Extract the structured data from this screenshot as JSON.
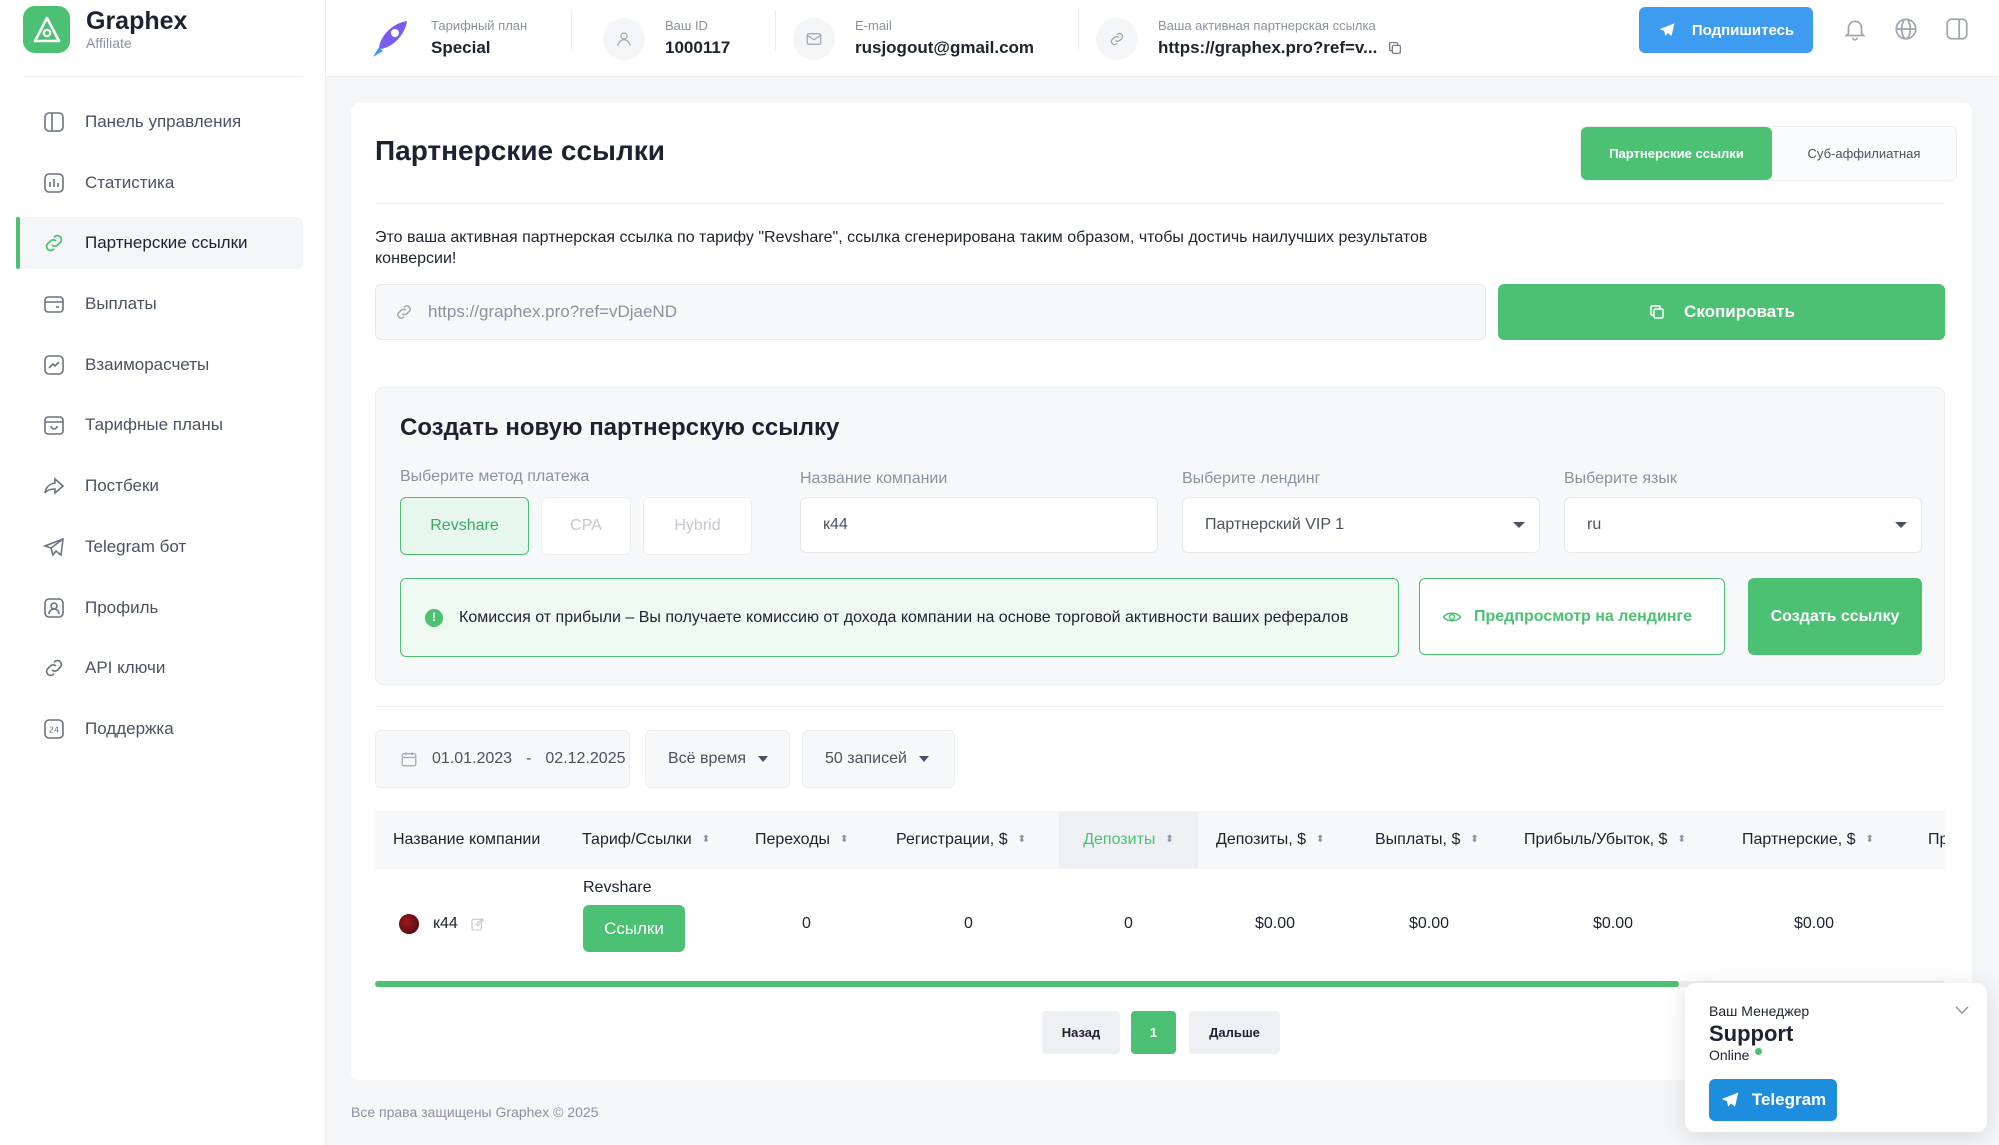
{
  "brand": {
    "name": "Graphex",
    "subtitle": "Affiliate",
    "accent": "#4cc174",
    "telegram_blue": "#3e9cf0"
  },
  "sidebar": {
    "items": [
      {
        "label": "Панель управления",
        "icon": "dashboard-icon"
      },
      {
        "label": "Статистика",
        "icon": "chart-icon"
      },
      {
        "label": "Партнерские ссылки",
        "icon": "link-icon",
        "active": true
      },
      {
        "label": "Выплаты",
        "icon": "wallet-icon"
      },
      {
        "label": "Взаиморасчеты",
        "icon": "trend-icon"
      },
      {
        "label": "Тарифные планы",
        "icon": "box-icon"
      },
      {
        "label": "Постбеки",
        "icon": "share-icon"
      },
      {
        "label": "Telegram бот",
        "icon": "telegram-icon"
      },
      {
        "label": "Профиль",
        "icon": "user-icon"
      },
      {
        "label": "API ключи",
        "icon": "key-link-icon"
      },
      {
        "label": "Поддержка",
        "icon": "support-24-icon"
      }
    ]
  },
  "topbar": {
    "plan": {
      "label": "Тарифный план",
      "value": "Special"
    },
    "user_id": {
      "label": "Ваш ID",
      "value": "1000117"
    },
    "email": {
      "label": "E-mail",
      "value": "rusjogout@gmail.com"
    },
    "active_link": {
      "label": "Ваша активная партнерская ссылка",
      "value": "https://graphex.pro?ref=v..."
    },
    "subscribe_label": "Подпишитесь"
  },
  "page": {
    "title": "Партнерские ссылки",
    "tabs": [
      {
        "label": "Партнерские ссылки",
        "active": true
      },
      {
        "label": "Суб-аффилиатная"
      }
    ],
    "description": "Это ваша активная партнерская ссылка по тарифу \"Revshare\", ссылка сгенерирована таким образом, чтобы достичь наилучших результатов конверсии!",
    "link_value": "https://graphex.pro?ref=vDjaeND",
    "copy_label": "Скопировать"
  },
  "create": {
    "title": "Создать новую партнерскую ссылку",
    "method_label": "Выберите метод платежа",
    "methods": [
      "Revshare",
      "CPA",
      "Hybrid"
    ],
    "company_label": "Название компании",
    "company_value": "к44",
    "landing_label": "Выберите лендинг",
    "landing_value": "Партнерский VIP 1",
    "lang_label": "Выберите язык",
    "lang_value": "ru",
    "info_text": "Комиссия от прибыли – Вы получаете комиссию от дохода компании на основе торговой активности ваших рефералов",
    "info_mark": "!",
    "preview_label": "Предпросмотр на лендинге",
    "create_label": "Создать ссылку"
  },
  "filters": {
    "date_from": "01.01.2023",
    "date_sep": "-",
    "date_to": "02.12.2025",
    "period": "Всё время",
    "per_page": "50 записей"
  },
  "table": {
    "headers": [
      "Название компании",
      "Тариф/Ссылки",
      "Переходы",
      "Регистрации, $",
      "Депозиты",
      "Депозиты, $",
      "Выплаты, $",
      "Прибыль/Убыток, $",
      "Партнерские, $",
      "Пр"
    ],
    "sort_glyph": "⬍",
    "row": {
      "company": "к44",
      "plan": "Revshare",
      "links_label": "Ссылки",
      "clicks": "0",
      "registrations": "0",
      "deposits": "0",
      "deposits_usd": "$0.00",
      "payouts_usd": "$0.00",
      "profit_usd": "$0.00",
      "partner_usd": "$0.00"
    }
  },
  "pagination": {
    "prev": "Назад",
    "current": "1",
    "next": "Дальше"
  },
  "footer": "Все права защищены Graphex © 2025",
  "manager": {
    "label": "Ваш Менеджер",
    "name": "Support",
    "status": "Online",
    "button": "Telegram"
  }
}
